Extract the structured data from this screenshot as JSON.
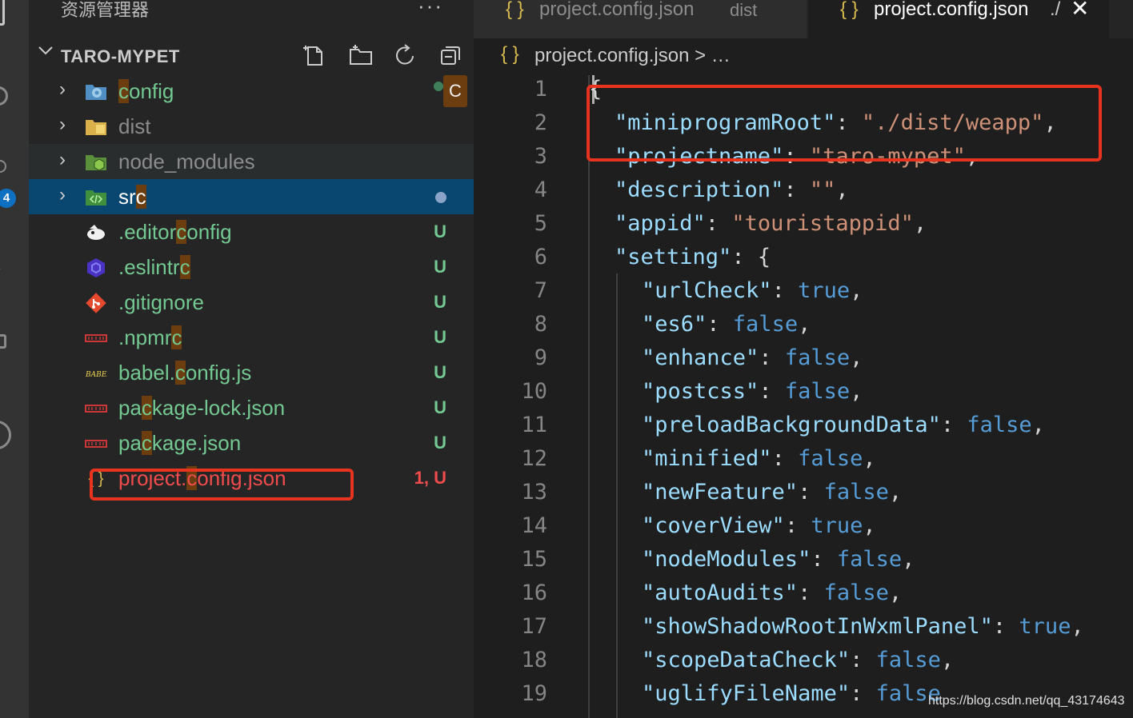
{
  "sidebar": {
    "title": "资源管理器",
    "more": "···",
    "project": "TARO-MYPET",
    "badge": "4",
    "items": [
      {
        "label": "config",
        "type": "folder",
        "deco": "",
        "badge": "C"
      },
      {
        "label": "dist",
        "type": "folder",
        "deco": ""
      },
      {
        "label": "node_modules",
        "type": "folder",
        "deco": ""
      },
      {
        "label": "src",
        "type": "folder",
        "deco": ""
      },
      {
        "label": ".editorconfig",
        "type": "file",
        "deco": "U"
      },
      {
        "label": ".eslintrc",
        "type": "file",
        "deco": "U"
      },
      {
        "label": ".gitignore",
        "type": "file",
        "deco": "U"
      },
      {
        "label": ".npmrc",
        "type": "file",
        "deco": "U"
      },
      {
        "label": "babel.config.js",
        "type": "file",
        "deco": "U"
      },
      {
        "label": "package-lock.json",
        "type": "file",
        "deco": "U"
      },
      {
        "label": "package.json",
        "type": "file",
        "deco": "U"
      },
      {
        "label": "project.config.json",
        "type": "file",
        "deco": "1, U"
      }
    ],
    "icons": {
      "json": "{ }",
      "babel": "BABEL"
    }
  },
  "tabs": [
    {
      "icon": "{ }",
      "name": "project.config.json",
      "desc": "dist",
      "active": false
    },
    {
      "icon": "{ }",
      "name": "project.config.json",
      "desc": "./",
      "active": true,
      "close": "✕"
    }
  ],
  "breadcrumb": {
    "icon": "{ }",
    "file": "project.config.json",
    "rest": " > …"
  },
  "editor": {
    "lines": [
      {
        "n": "1"
      },
      {
        "n": "2"
      },
      {
        "n": "3"
      },
      {
        "n": "4"
      },
      {
        "n": "5"
      },
      {
        "n": "6"
      },
      {
        "n": "7"
      },
      {
        "n": "8"
      },
      {
        "n": "9"
      },
      {
        "n": "10"
      },
      {
        "n": "11"
      },
      {
        "n": "12"
      },
      {
        "n": "13"
      },
      {
        "n": "14"
      },
      {
        "n": "15"
      },
      {
        "n": "16"
      },
      {
        "n": "17"
      },
      {
        "n": "18"
      },
      {
        "n": "19"
      }
    ],
    "code": {
      "l1": "{",
      "l2k": "\"miniprogramRoot\"",
      "l2v": "\"./dist/weapp\"",
      "l3k": "\"projectname\"",
      "l3v": "\"taro-mypet\"",
      "l4k": "\"description\"",
      "l4v": "\"\"",
      "l5k": "\"appid\"",
      "l5v": "\"touristappid\"",
      "l6k": "\"setting\"",
      "l6v": "{",
      "l7k": "\"urlCheck\"",
      "l7v": "true",
      "l8k": "\"es6\"",
      "l8v": "false",
      "l9k": "\"enhance\"",
      "l9v": "false",
      "l10k": "\"postcss\"",
      "l10v": "false",
      "l11k": "\"preloadBackgroundData\"",
      "l11v": "false",
      "l12k": "\"minified\"",
      "l12v": "false",
      "l13k": "\"newFeature\"",
      "l13v": "false",
      "l14k": "\"coverView\"",
      "l14v": "true",
      "l15k": "\"nodeModules\"",
      "l15v": "false",
      "l16k": "\"autoAudits\"",
      "l16v": "false",
      "l17k": "\"showShadowRootInWxmlPanel\"",
      "l17v": "true",
      "l18k": "\"scopeDataCheck\"",
      "l18v": "false",
      "l19k": "\"uglifyFileName\"",
      "l19v": "false"
    }
  },
  "watermark": "https://blog.csdn.net/qq_43174643",
  "colors": {
    "accent": "#0e70c0",
    "annotation": "#e8331f",
    "untracked": "#73c991",
    "error": "#f14c4c"
  }
}
